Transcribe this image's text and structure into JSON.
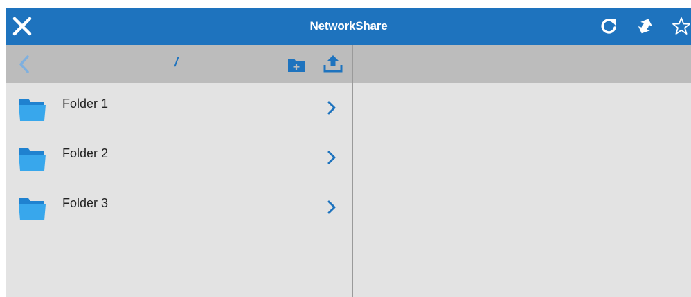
{
  "header": {
    "title": "NetworkShare",
    "close_icon": "close-icon",
    "refresh_icon": "refresh-icon",
    "sync_icon": "sync-arrows-icon",
    "favorite_icon": "star-outline-icon",
    "background": "#1e73be"
  },
  "browser": {
    "path": "/",
    "back_icon": "chevron-left-icon",
    "new_folder_icon": "new-folder-icon",
    "upload_icon": "upload-icon",
    "items": [
      {
        "label": "Folder 1",
        "icon": "folder-icon"
      },
      {
        "label": "Folder 2",
        "icon": "folder-icon"
      },
      {
        "label": "Folder 3",
        "icon": "folder-icon"
      }
    ]
  },
  "colors": {
    "accent": "#1e73be",
    "folder": "#35a4e8",
    "pane_bg": "#e3e3e3",
    "subbar_bg": "#bcbcbc"
  }
}
